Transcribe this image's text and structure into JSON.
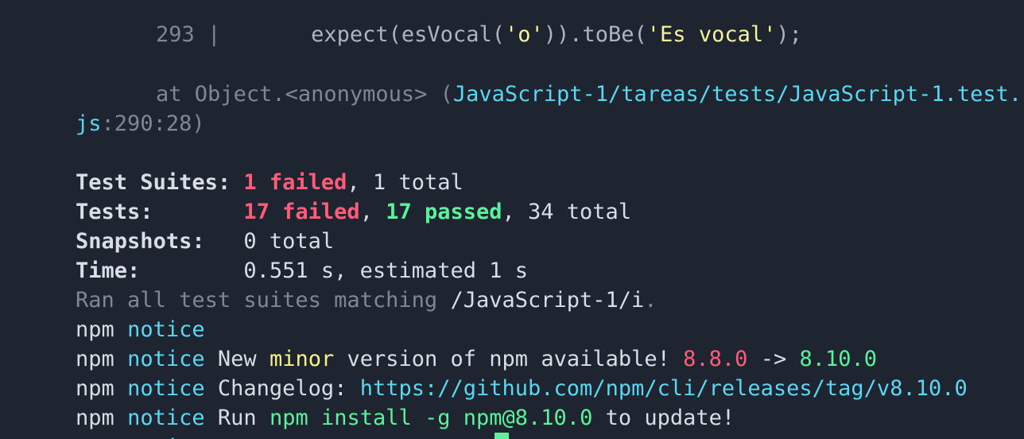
{
  "code_frame": {
    "line_number": "293",
    "gutter": " |",
    "code_prefix": "expect(esVocal(",
    "code_arg": "'o'",
    "code_mid": ")).toBe(",
    "code_expected": "'Es vocal'",
    "code_suffix": ");"
  },
  "stack_trace": {
    "prefix": "at Object.<anonymous> (",
    "path_line1": "JavaScript-1/tareas/tests/JavaScript-1.test.",
    "path_line2": "js",
    "position": ":290:28)"
  },
  "summary": {
    "suites_label": "Test Suites:",
    "suites_failed": "1 failed",
    "suites_total": ", 1 total",
    "tests_label": "Tests:",
    "tests_failed": "17 failed",
    "sep": ", ",
    "tests_passed": "17 passed",
    "tests_total": ", 34 total",
    "snapshots_label": "Snapshots:",
    "snapshots_value": "0 total",
    "time_label": "Time:",
    "time_value": "0.551 s, estimated 1 s",
    "ran_prefix": "Ran all test suites matching",
    "ran_pattern": " /JavaScript-1/i",
    "ran_suffix": "."
  },
  "npm": {
    "prefix": "npm",
    "notice": "notice",
    "new_text_1": "New",
    "minor": "minor",
    "new_text_2": "version of npm available!",
    "old_version": "8.8.0",
    "arrow": "->",
    "new_version": "8.10.0",
    "changelog_label": "Changelog:",
    "changelog_url": "https://github.com/npm/cli/releases/tag/v8.10.0",
    "run_label": "Run",
    "install_cmd": "npm install -g npm@8.10.0",
    "to_update": "to update!"
  },
  "colors": {
    "background": "#1e2430",
    "failed": "#ff5c7a",
    "passed": "#5cf29b",
    "link": "#5ad7f2",
    "highlight": "#f5f28a"
  }
}
